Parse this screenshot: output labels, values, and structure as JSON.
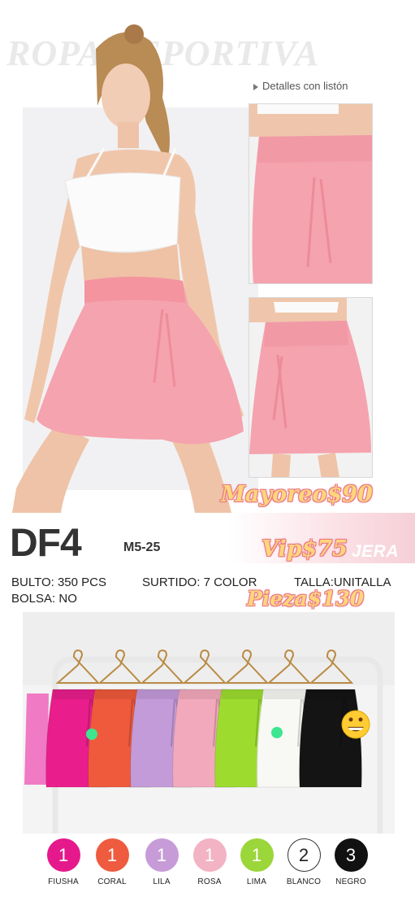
{
  "watermark": "ROPA DEPORTIVA",
  "detail_caption": "Detalles con listón",
  "product": {
    "code": "DF4",
    "sizes": "M5-25"
  },
  "prices": {
    "mayoreo": "Mayoreo$90",
    "vip": "Vip$75",
    "pieza": "Pieza$130",
    "jera": "JERA"
  },
  "info": {
    "bulto": "BULTO: 350 PCS",
    "surtido": "SURTIDO: 7 COLOR",
    "talla": "TALLA:UNITALLA",
    "bolsa": "BOLSA: NO"
  },
  "colors_accent": {
    "skirt_pink": "#f5a3ae",
    "price_fill": "#ffd67a",
    "price_outline": "#e56f83"
  },
  "swatches": [
    {
      "count": "1",
      "name": "FIUSHA",
      "color": "#e5198c"
    },
    {
      "count": "1",
      "name": "CORAL",
      "color": "#ee5b3f"
    },
    {
      "count": "1",
      "name": "LILA",
      "color": "#c79bd8"
    },
    {
      "count": "1",
      "name": "ROSA",
      "color": "#f2b3c4"
    },
    {
      "count": "1",
      "name": "LIMA",
      "color": "#9bd63a"
    },
    {
      "count": "2",
      "name": "BLANCO",
      "color": "#ffffff"
    },
    {
      "count": "3",
      "name": "NEGRO",
      "color": "#111111"
    }
  ],
  "rack_skirts": [
    {
      "name": "fiusha",
      "color": "#e91e8c"
    },
    {
      "name": "coral",
      "color": "#ef5a3c"
    },
    {
      "name": "lila",
      "color": "#c49bd9"
    },
    {
      "name": "rosa",
      "color": "#f3a9bc"
    },
    {
      "name": "lima",
      "color": "#9ddc2f"
    },
    {
      "name": "blanco",
      "color": "#f8f8f5"
    },
    {
      "name": "negro",
      "color": "#141414"
    }
  ]
}
